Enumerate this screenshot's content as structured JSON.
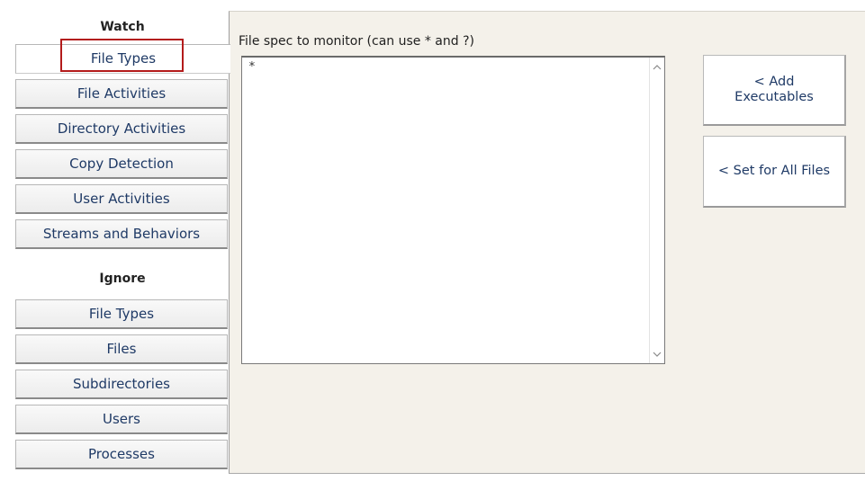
{
  "sidebar": {
    "watch_heading": "Watch",
    "watch_items": [
      {
        "label": "File Types"
      },
      {
        "label": "File Activities"
      },
      {
        "label": "Directory Activities"
      },
      {
        "label": "Copy Detection"
      },
      {
        "label": "User Activities"
      },
      {
        "label": "Streams and Behaviors"
      }
    ],
    "ignore_heading": "Ignore",
    "ignore_items": [
      {
        "label": "File Types"
      },
      {
        "label": "Files"
      },
      {
        "label": "Subdirectories"
      },
      {
        "label": "Users"
      },
      {
        "label": "Processes"
      }
    ],
    "active_item": "File Types"
  },
  "panel": {
    "spec_label": "File spec to monitor (can use * and ?)",
    "spec_value": "*",
    "scroll_up_icon": "chevron-up-icon",
    "scroll_down_icon": "chevron-down-icon",
    "add_executables_label": "< Add\nExecutables",
    "set_all_files_label": "< Set for All Files"
  },
  "colors": {
    "panel_background": "#f4f1ea",
    "highlight_border": "#b31b1b",
    "button_text": "#1f3a66"
  }
}
